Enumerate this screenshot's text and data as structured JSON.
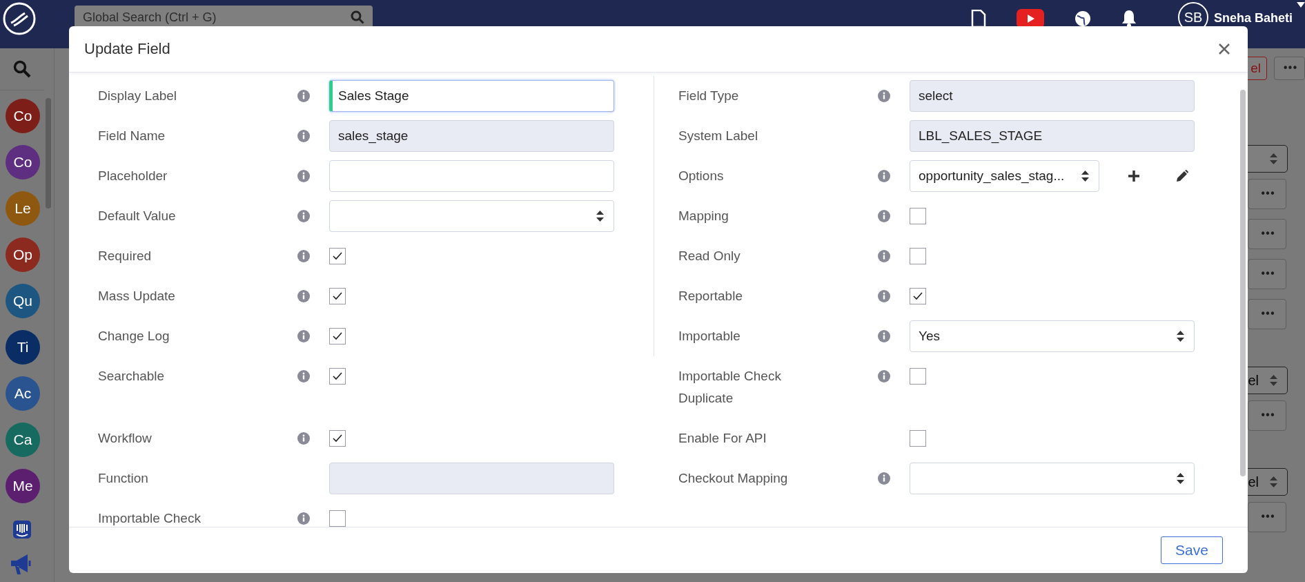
{
  "topbar": {
    "search": {
      "placeholder": "Global Search (Ctrl + G)"
    },
    "user": {
      "initials": "SB",
      "name": "Sneha Baheti"
    }
  },
  "sidebar": {
    "avatars": [
      {
        "initials": "Co",
        "color": "#7d1f18"
      },
      {
        "initials": "Co",
        "color": "#5e2f80"
      },
      {
        "initials": "Le",
        "color": "#8f5810"
      },
      {
        "initials": "Op",
        "color": "#8c2a20"
      },
      {
        "initials": "Qu",
        "color": "#1d5680"
      },
      {
        "initials": "Ti",
        "color": "#0b2d66"
      },
      {
        "initials": "Ac",
        "color": "#2a5490"
      },
      {
        "initials": "Ca",
        "color": "#166a60"
      },
      {
        "initials": "Me",
        "color": "#5c1f70"
      }
    ]
  },
  "background": {
    "header_actions": [
      {
        "kind": "cancel",
        "label": "el"
      },
      {
        "kind": "more",
        "label": "•••"
      }
    ],
    "items": [
      {
        "kind": "select"
      },
      {
        "kind": "more",
        "label": "•••"
      },
      {
        "kind": "more",
        "label": "•••"
      },
      {
        "kind": "more",
        "label": "•••"
      },
      {
        "kind": "more",
        "label": "•••"
      },
      {
        "kind": "select",
        "value": "el"
      },
      {
        "kind": "more",
        "label": "•••"
      },
      {
        "kind": "select",
        "value": "el"
      },
      {
        "kind": "more",
        "label": "•••"
      }
    ]
  },
  "dialog": {
    "title": "Update Field",
    "left_fields": [
      {
        "label": "Display Label",
        "info": true,
        "kind": "text",
        "value": "Sales Stage",
        "focused": true
      },
      {
        "label": "Field Name",
        "info": true,
        "kind": "readonly",
        "value": "sales_stage"
      },
      {
        "label": "Placeholder",
        "info": true,
        "kind": "text",
        "focused": false
      },
      {
        "label": "Default Value",
        "info": true,
        "kind": "select"
      },
      {
        "label": "Required",
        "info": true,
        "kind": "checkbox",
        "checked": true
      },
      {
        "label": "Mass Update",
        "info": true,
        "kind": "checkbox",
        "checked": true
      },
      {
        "label": "Change Log",
        "info": true,
        "kind": "checkbox",
        "checked": true
      },
      {
        "label": "Searchable",
        "info": true,
        "kind": "checkbox",
        "checked": true
      },
      {
        "label": "Workflow",
        "info": true,
        "kind": "checkbox",
        "checked": true
      },
      {
        "label": "Function",
        "info": false,
        "kind": "readonly"
      },
      {
        "label": "Importable Check",
        "info": true,
        "kind": "checkbox",
        "checked": false
      }
    ],
    "right_fields": [
      {
        "label": "Field Type",
        "info": true,
        "kind": "readonly",
        "value": "select"
      },
      {
        "label": "System Label",
        "info": false,
        "kind": "readonly",
        "value": "LBL_SALES_STAGE"
      },
      {
        "label": "Options",
        "info": true,
        "kind": "options",
        "value": "opportunity_sales_stag..."
      },
      {
        "label": "Mapping",
        "info": true,
        "kind": "checkbox",
        "checked": false
      },
      {
        "label": "Read Only",
        "info": true,
        "kind": "checkbox",
        "checked": false
      },
      {
        "label": "Reportable",
        "info": true,
        "kind": "checkbox",
        "checked": true
      },
      {
        "label": "Importable",
        "info": true,
        "kind": "select",
        "value": "Yes"
      },
      {
        "label": "Importable Check Duplicate",
        "info": true,
        "kind": "checkbox",
        "checked": false
      },
      {
        "label": "Enable For API",
        "info": false,
        "kind": "checkbox",
        "checked": false
      },
      {
        "label": "Checkout Mapping",
        "info": true,
        "kind": "select"
      }
    ],
    "save_button": "Save"
  }
}
